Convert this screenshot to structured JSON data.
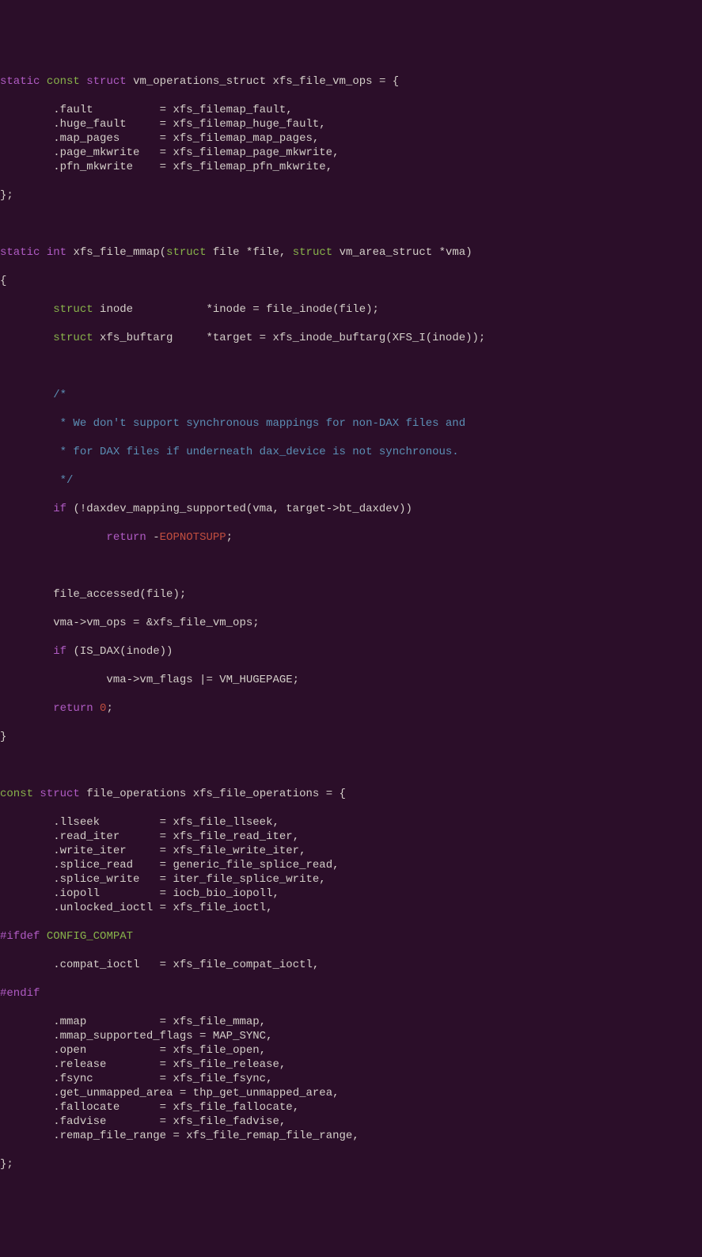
{
  "code": {
    "struct_name": "vm_operations_struct",
    "var_name": "xfs_file_vm_ops",
    "vm_ops": [
      {
        "field": ".fault",
        "pad": "          ",
        "value": "xfs_filemap_fault"
      },
      {
        "field": ".huge_fault",
        "pad": "     ",
        "value": "xfs_filemap_huge_fault"
      },
      {
        "field": ".map_pages",
        "pad": "      ",
        "value": "xfs_filemap_map_pages"
      },
      {
        "field": ".page_mkwrite",
        "pad": "   ",
        "value": "xfs_filemap_page_mkwrite"
      },
      {
        "field": ".pfn_mkwrite",
        "pad": "    ",
        "value": "xfs_filemap_pfn_mkwrite"
      }
    ],
    "mmap_fn": "xfs_file_mmap",
    "mmap_params": {
      "p1_type": "struct",
      "p1_name": "file *file",
      "p2_type": "struct",
      "p2_name": "vm_area_struct *vma"
    },
    "mmap_body": {
      "l1_type": "struct",
      "l1_decl": "inode           *inode = file_inode(file);",
      "l2_type": "struct",
      "l2_decl": "xfs_buftarg     *target = xfs_inode_buftarg(XFS_I(inode));",
      "cmt1": "/*",
      "cmt2": " * We don't support synchronous mappings for non-DAX files and",
      "cmt3": " * for DAX files if underneath dax_device is not synchronous.",
      "cmt4": " */",
      "if_kw": "if",
      "if_cond": "(!daxdev_mapping_supported(vma, target->bt_daxdev))",
      "ret_kw": "return",
      "ret_neg": " -",
      "ret_err": "EOPNOTSUPP",
      "ret_semi": ";",
      "s1": "file_accessed(file);",
      "s2": "vma->vm_ops = &xfs_file_vm_ops;",
      "if2_kw": "if",
      "if2_cond": "(IS_DAX(inode))",
      "s3": "vma->vm_flags |= VM_HUGEPAGE;",
      "ret2_kw": "return",
      "ret2_sp": " ",
      "ret2_val": "0",
      "ret2_semi": ";"
    },
    "fops_decl": {
      "const_kw": "const",
      "struct_kw": "struct",
      "type": "file_operations",
      "name": "xfs_file_operations"
    },
    "fops1": [
      {
        "field": ".llseek",
        "pad": "         ",
        "value": "xfs_file_llseek"
      },
      {
        "field": ".read_iter",
        "pad": "      ",
        "value": "xfs_file_read_iter"
      },
      {
        "field": ".write_iter",
        "pad": "     ",
        "value": "xfs_file_write_iter"
      },
      {
        "field": ".splice_read",
        "pad": "    ",
        "value": "generic_file_splice_read"
      },
      {
        "field": ".splice_write",
        "pad": "   ",
        "value": "iter_file_splice_write"
      },
      {
        "field": ".iopoll",
        "pad": "         ",
        "value": "iocb_bio_iopoll"
      },
      {
        "field": ".unlocked_ioctl",
        "pad": " ",
        "value": "xfs_file_ioctl"
      }
    ],
    "ifdef_kw": "#ifdef",
    "ifdef_sym": "CONFIG_COMPAT",
    "fops_compat": {
      "field": ".compat_ioctl",
      "pad": "   ",
      "value": "xfs_file_compat_ioctl"
    },
    "endif_kw": "#endif",
    "fops2": [
      {
        "field": ".mmap",
        "pad": "           ",
        "value": "xfs_file_mmap"
      },
      {
        "field": ".mmap_supported_flags",
        "pad": " ",
        "value": "MAP_SYNC"
      },
      {
        "field": ".open",
        "pad": "           ",
        "value": "xfs_file_open"
      },
      {
        "field": ".release",
        "pad": "        ",
        "value": "xfs_file_release"
      },
      {
        "field": ".fsync",
        "pad": "          ",
        "value": "xfs_file_fsync"
      },
      {
        "field": ".get_unmapped_area",
        "pad": " ",
        "value": "thp_get_unmapped_area"
      },
      {
        "field": ".fallocate",
        "pad": "      ",
        "value": "xfs_file_fallocate"
      },
      {
        "field": ".fadvise",
        "pad": "        ",
        "value": "xfs_file_fadvise"
      },
      {
        "field": ".remap_file_range",
        "pad": " ",
        "value": "xfs_file_remap_file_range"
      }
    ]
  }
}
